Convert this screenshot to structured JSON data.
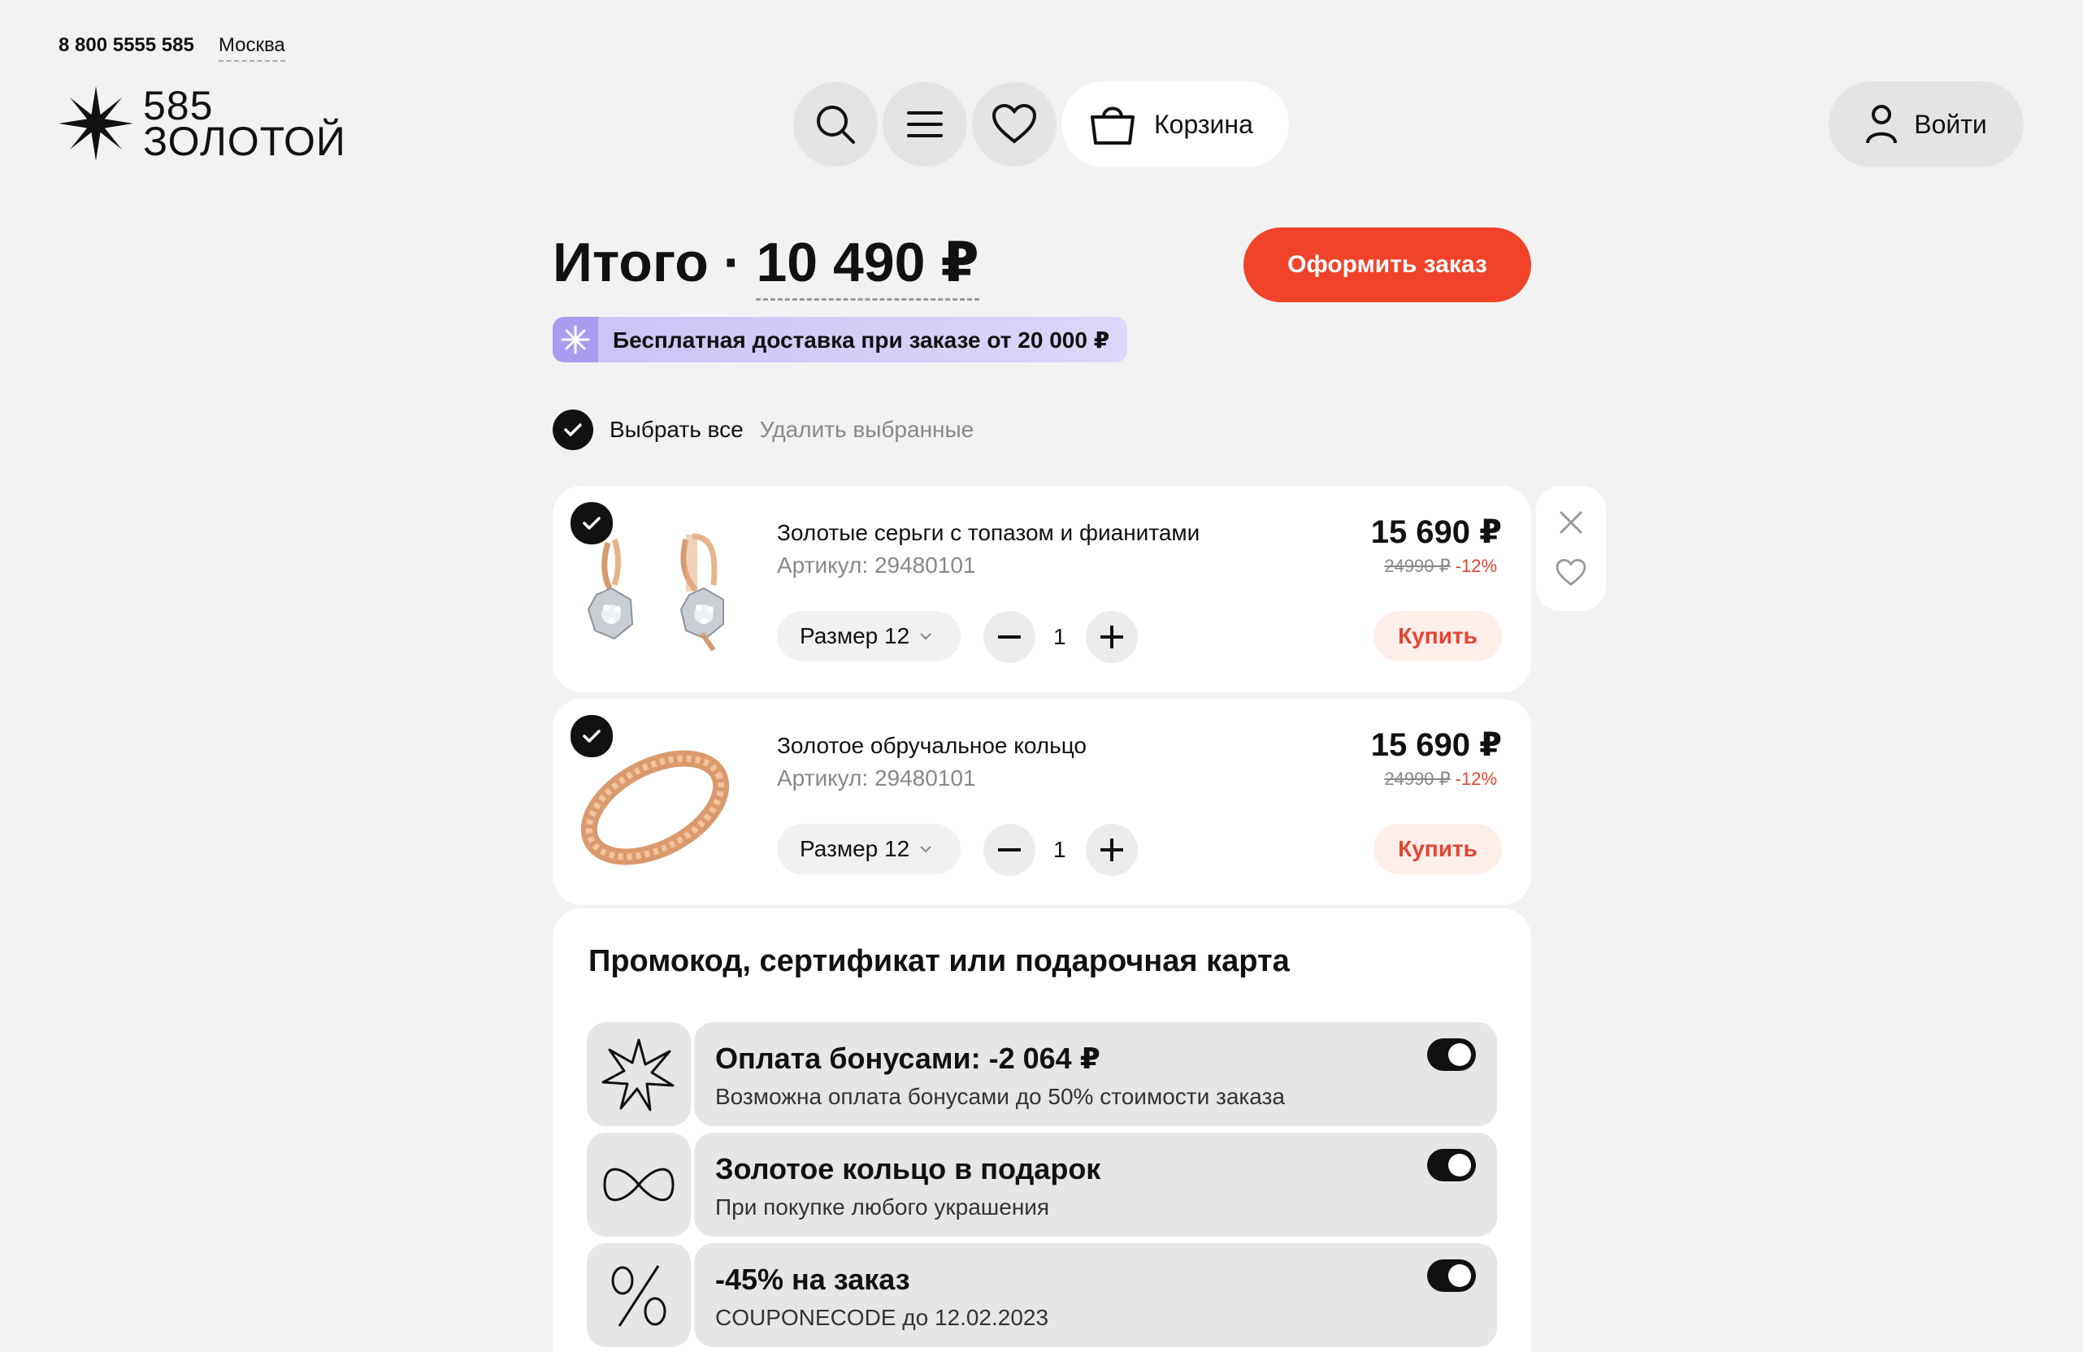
{
  "header": {
    "phone": "8 800 5555 585",
    "city": "Москва",
    "logo_top": "585",
    "logo_bottom": "ЗОЛОТОЙ",
    "cart_label": "Корзина",
    "login_label": "Войти"
  },
  "summary": {
    "total_label": "Итого",
    "separator": "·",
    "total_amount": "10 490 ₽",
    "order_button": "Оформить заказ",
    "delivery_banner": "Бесплатная доставка при заказе от 20 000 ₽"
  },
  "selection": {
    "select_all": "Выбрать все",
    "delete_selected": "Удалить выбранные"
  },
  "items": [
    {
      "title": "Золотые серьги с топазом и фианитами",
      "article": "Артикул: 29480101",
      "price": "15 690 ₽",
      "old_price": "24990 ₽",
      "discount": "-12%",
      "size": "Размер 12",
      "qty": "1",
      "buy": "Купить"
    },
    {
      "title": "Золотое обручальное кольцо",
      "article": "Артикул: 29480101",
      "price": "15 690 ₽",
      "old_price": "24990 ₽",
      "discount": "-12%",
      "size": "Размер 12",
      "qty": "1",
      "buy": "Купить"
    }
  ],
  "promo": {
    "heading": "Промокод, сертификат или подарочная карта",
    "offers": [
      {
        "icon": "starburst-icon",
        "title": "Оплата бонусами: -2 064 ₽",
        "subtitle": "Возможна оплата бонусами до 50% стоимости заказа",
        "enabled": true
      },
      {
        "icon": "ribbon-icon",
        "title": "Золотое кольцо в подарок",
        "subtitle": "При покупке любого украшения",
        "enabled": true
      },
      {
        "icon": "percent-icon",
        "title": "-45% на заказ",
        "subtitle": "COUPONECODE до 12.02.2023",
        "enabled": true
      }
    ]
  },
  "colors": {
    "accent": "#f0432a",
    "discount": "#e5442f",
    "banner": "#c9c2f5",
    "background": "#f2f2f2"
  }
}
